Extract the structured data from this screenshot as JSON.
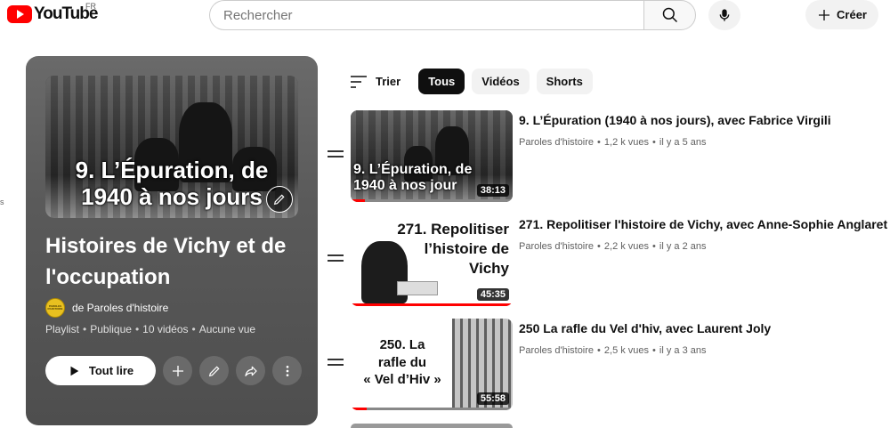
{
  "header": {
    "logo_text": "YouTube",
    "country": "FR",
    "search_placeholder": "Rechercher",
    "create_label": "Créer"
  },
  "edge_text": "s",
  "playlist": {
    "thumb_caption_line1": "9. L’Épuration, de",
    "thumb_caption_line2": "1940 à nos jours",
    "title": "Histoires de Vichy et de l'occupation",
    "owner": "de Paroles d'histoire",
    "avatar_text": "PAROLES D'HISTOIRE",
    "meta": [
      "Playlist",
      "Publique",
      "10 vidéos",
      "Aucune vue"
    ],
    "play_all_label": "Tout lire"
  },
  "filters": {
    "sort_label": "Trier",
    "chips": [
      "Tous",
      "Vidéos",
      "Shorts"
    ],
    "active": "Tous"
  },
  "videos": [
    {
      "title": "9. L’Épuration (1940 à nos jours), avec Fabrice Virgili",
      "channel": "Paroles d'histoire",
      "views": "1,2 k vues",
      "age": "il y a 5 ans",
      "duration": "38:13",
      "thumb_line1": "9. L’Épuration, de",
      "thumb_line2": "1940 à nos jour",
      "progress": 0.09
    },
    {
      "title": "271. Repolitiser l'histoire de Vichy, avec Anne-Sophie Anglaret",
      "channel": "Paroles d'histoire",
      "views": "2,2 k vues",
      "age": "il y a 2 ans",
      "duration": "45:35",
      "thumb_line1": "271. Repolitiser",
      "thumb_line2": "l’histoire de",
      "thumb_line3": "Vichy",
      "progress": 1.0
    },
    {
      "title": "250 La rafle du Vel d'hiv, avec Laurent Joly",
      "channel": "Paroles d'histoire",
      "views": "2,5 k vues",
      "age": "il y a 3 ans",
      "duration": "55:58",
      "thumb_line1": "250. La",
      "thumb_line2": "rafle du",
      "thumb_line3": "« Vel d’Hiv »",
      "progress": 0.1
    }
  ],
  "colors": {
    "brand": "#ff0000",
    "panel": "#5a5a5a"
  }
}
